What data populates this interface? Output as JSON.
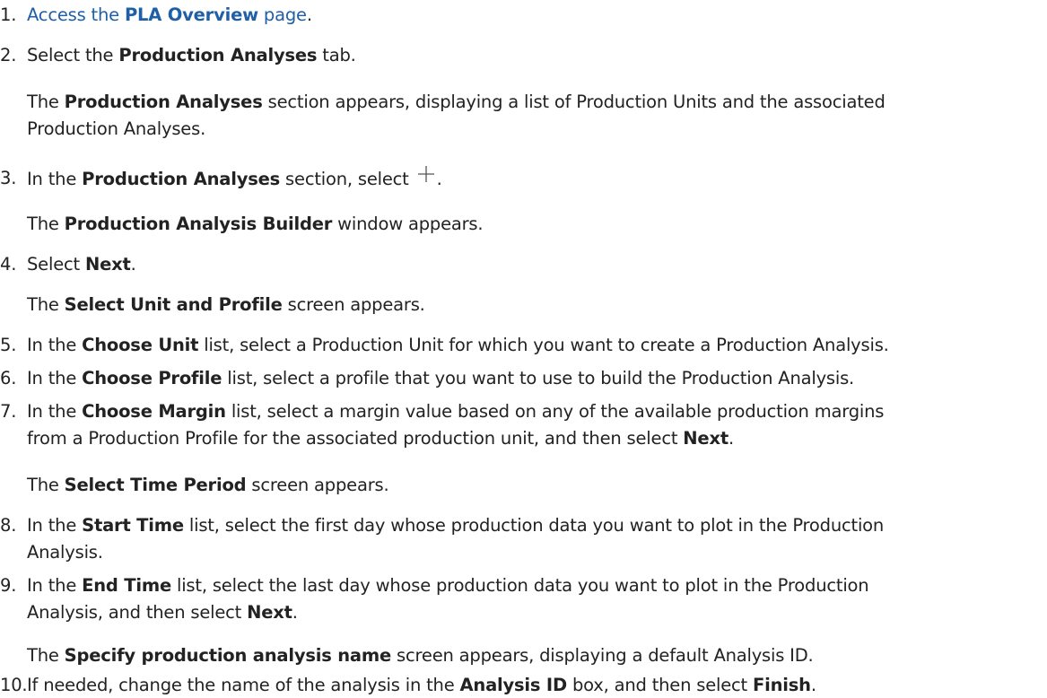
{
  "steps": [
    {
      "num": "1.",
      "prefix": "Access the ",
      "link_bold": "PLA Overview",
      "link_suffix": " page",
      "suffix": "."
    },
    {
      "num": "2.",
      "a": "Select the ",
      "b1": "Production Analyses",
      "c": " tab.",
      "note_b": "Production Analyses",
      "note_line1": " section appears, displaying a list of Production Units and the associated",
      "note_line2": "Production Analyses.",
      "note_prefix": "The "
    },
    {
      "num": "3.",
      "a": "In the ",
      "b1": "Production Analyses",
      "c": " section, select ",
      "icon": "plus-icon",
      "d": ".",
      "note_prefix": "The ",
      "note_b": "Production Analysis Builder",
      "note_suffix": " window appears."
    },
    {
      "num": "4.",
      "a": "Select ",
      "b1": "Next",
      "c": ".",
      "note_prefix": "The ",
      "note_b": "Select Unit and Profile",
      "note_suffix": " screen appears."
    },
    {
      "num": "5.",
      "a": "In the ",
      "b1": "Choose Unit",
      "c": " list, select a Production Unit for which you want to create a Production Analysis."
    },
    {
      "num": "6.",
      "a": "In the ",
      "b1": "Choose Profile",
      "c": " list, select a profile that you want to use to build the Production Analysis."
    },
    {
      "num": "7.",
      "a": "In the ",
      "b1": "Choose Margin",
      "c": " list, select a margin value based on any of the available production margins",
      "line2a": "from a Production Profile for the associated production unit, and then select ",
      "line2b": "Next",
      "line2c": ".",
      "note_prefix": "The ",
      "note_b": "Select Time Period",
      "note_suffix": " screen appears."
    },
    {
      "num": "8.",
      "a": "In the ",
      "b1": "Start Time",
      "c": " list, select the first day whose production data you want to plot in the Production",
      "line2a": "Analysis."
    },
    {
      "num": "9.",
      "a": "In the ",
      "b1": "End Time",
      "c": " list, select the last day whose production data you want to plot in the Production",
      "line2a": "Analysis, and then select ",
      "line2b": "Next",
      "line2c": ".",
      "note_prefix": "The ",
      "note_b": "Specify production analysis name",
      "note_suffix": " screen appears, displaying a default Analysis ID."
    },
    {
      "num": "10.",
      "a": "If needed, change the name of the analysis in the ",
      "b1": "Analysis ID",
      "c": " box, and then select ",
      "b2": "Finish",
      "d": "."
    }
  ],
  "colors": {
    "text": "#222222",
    "link": "#1f5fa8"
  }
}
